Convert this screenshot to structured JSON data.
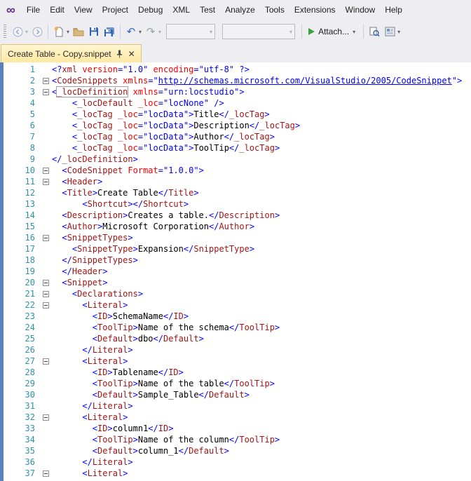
{
  "menu": {
    "items": [
      "File",
      "Edit",
      "View",
      "Project",
      "Debug",
      "XML",
      "Test",
      "Analyze",
      "Tools",
      "Extensions",
      "Window",
      "Help"
    ]
  },
  "toolbar": {
    "attach_label": "Attach...",
    "combo1_value": "",
    "combo2_value": ""
  },
  "tabs": [
    {
      "label": "Create Table - Copy.snippet",
      "pinned": true,
      "active": true
    }
  ],
  "colors": {
    "menu_bg": "#EEEEF2",
    "active_tab": "#FFE8A2",
    "window_border": "#5B82BE",
    "line_number": "#2B91AF",
    "xml_element": "#A31515",
    "xml_attribute": "#FF0000",
    "xml_delimiter_value": "#0000FF",
    "xml_text": "#000000",
    "attach_play": "#37A437",
    "logo_purple": "#5C2D91"
  },
  "editor": {
    "fold_lines": [
      2,
      3,
      10,
      11,
      16,
      20,
      21,
      22,
      27,
      32,
      37
    ],
    "lines": [
      [
        [
          "d",
          "<?"
        ],
        [
          "e",
          "xml"
        ],
        [
          "a",
          " version"
        ],
        [
          "d",
          "="
        ],
        [
          "v",
          "\"1.0\""
        ],
        [
          "a",
          " encoding"
        ],
        [
          "d",
          "="
        ],
        [
          "v",
          "\"utf-8\""
        ],
        [
          "d",
          " ?>"
        ]
      ],
      [
        [
          "d",
          "<"
        ],
        [
          "e",
          "CodeSnippets"
        ],
        [
          "a",
          " xmlns"
        ],
        [
          "d",
          "=\""
        ],
        [
          "u",
          "http://schemas.microsoft.com/VisualStudio/2005/CodeSnippet"
        ],
        [
          "d",
          "\">"
        ]
      ],
      [
        [
          "d",
          "<"
        ],
        [
          "b",
          "_locDefinition"
        ],
        [
          "a",
          " xmlns"
        ],
        [
          "d",
          "="
        ],
        [
          "v",
          "\"urn:locstudio\""
        ],
        [
          "d",
          ">"
        ]
      ],
      [
        [
          "t",
          "    "
        ],
        [
          "d",
          "<"
        ],
        [
          "e",
          "_locDefault"
        ],
        [
          "a",
          " _loc"
        ],
        [
          "d",
          "="
        ],
        [
          "v",
          "\"locNone\""
        ],
        [
          "d",
          " />"
        ]
      ],
      [
        [
          "t",
          "    "
        ],
        [
          "d",
          "<"
        ],
        [
          "e",
          "_locTag"
        ],
        [
          "a",
          " _loc"
        ],
        [
          "d",
          "="
        ],
        [
          "v",
          "\"locData\""
        ],
        [
          "d",
          ">"
        ],
        [
          "t",
          "Title"
        ],
        [
          "d",
          "</"
        ],
        [
          "e",
          "_locTag"
        ],
        [
          "d",
          ">"
        ]
      ],
      [
        [
          "t",
          "    "
        ],
        [
          "d",
          "<"
        ],
        [
          "e",
          "_locTag"
        ],
        [
          "a",
          " _loc"
        ],
        [
          "d",
          "="
        ],
        [
          "v",
          "\"locData\""
        ],
        [
          "d",
          ">"
        ],
        [
          "t",
          "Description"
        ],
        [
          "d",
          "</"
        ],
        [
          "e",
          "_locTag"
        ],
        [
          "d",
          ">"
        ]
      ],
      [
        [
          "t",
          "    "
        ],
        [
          "d",
          "<"
        ],
        [
          "e",
          "_locTag"
        ],
        [
          "a",
          " _loc"
        ],
        [
          "d",
          "="
        ],
        [
          "v",
          "\"locData\""
        ],
        [
          "d",
          ">"
        ],
        [
          "t",
          "Author"
        ],
        [
          "d",
          "</"
        ],
        [
          "e",
          "_locTag"
        ],
        [
          "d",
          ">"
        ]
      ],
      [
        [
          "t",
          "    "
        ],
        [
          "d",
          "<"
        ],
        [
          "e",
          "_locTag"
        ],
        [
          "a",
          " _loc"
        ],
        [
          "d",
          "="
        ],
        [
          "v",
          "\"locData\""
        ],
        [
          "d",
          ">"
        ],
        [
          "t",
          "ToolTip"
        ],
        [
          "d",
          "</"
        ],
        [
          "e",
          "_locTag"
        ],
        [
          "d",
          ">"
        ]
      ],
      [
        [
          "d",
          "</"
        ],
        [
          "e",
          "_locDefinition"
        ],
        [
          "d",
          ">"
        ]
      ],
      [
        [
          "t",
          "  "
        ],
        [
          "d",
          "<"
        ],
        [
          "e",
          "CodeSnippet"
        ],
        [
          "a",
          " Format"
        ],
        [
          "d",
          "="
        ],
        [
          "v",
          "\"1.0.0\""
        ],
        [
          "d",
          ">"
        ]
      ],
      [
        [
          "t",
          "  "
        ],
        [
          "d",
          "<"
        ],
        [
          "e",
          "Header"
        ],
        [
          "d",
          ">"
        ]
      ],
      [
        [
          "t",
          "  "
        ],
        [
          "d",
          "<"
        ],
        [
          "e",
          "Title"
        ],
        [
          "d",
          ">"
        ],
        [
          "t",
          "Create Table"
        ],
        [
          "d",
          "</"
        ],
        [
          "e",
          "Title"
        ],
        [
          "d",
          ">"
        ]
      ],
      [
        [
          "t",
          "      "
        ],
        [
          "d",
          "<"
        ],
        [
          "e",
          "Shortcut"
        ],
        [
          "d",
          "></"
        ],
        [
          "e",
          "Shortcut"
        ],
        [
          "d",
          ">"
        ]
      ],
      [
        [
          "t",
          "  "
        ],
        [
          "d",
          "<"
        ],
        [
          "e",
          "Description"
        ],
        [
          "d",
          ">"
        ],
        [
          "t",
          "Creates a table."
        ],
        [
          "d",
          "</"
        ],
        [
          "e",
          "Description"
        ],
        [
          "d",
          ">"
        ]
      ],
      [
        [
          "t",
          "  "
        ],
        [
          "d",
          "<"
        ],
        [
          "e",
          "Author"
        ],
        [
          "d",
          ">"
        ],
        [
          "t",
          "Microsoft Corporation"
        ],
        [
          "d",
          "</"
        ],
        [
          "e",
          "Author"
        ],
        [
          "d",
          ">"
        ]
      ],
      [
        [
          "t",
          "  "
        ],
        [
          "d",
          "<"
        ],
        [
          "e",
          "SnippetTypes"
        ],
        [
          "d",
          ">"
        ]
      ],
      [
        [
          "t",
          "    "
        ],
        [
          "d",
          "<"
        ],
        [
          "e",
          "SnippetType"
        ],
        [
          "d",
          ">"
        ],
        [
          "t",
          "Expansion"
        ],
        [
          "d",
          "</"
        ],
        [
          "e",
          "SnippetType"
        ],
        [
          "d",
          ">"
        ]
      ],
      [
        [
          "t",
          "  "
        ],
        [
          "d",
          "</"
        ],
        [
          "e",
          "SnippetTypes"
        ],
        [
          "d",
          ">"
        ]
      ],
      [
        [
          "t",
          "  "
        ],
        [
          "d",
          "</"
        ],
        [
          "e",
          "Header"
        ],
        [
          "d",
          ">"
        ]
      ],
      [
        [
          "t",
          "  "
        ],
        [
          "d",
          "<"
        ],
        [
          "e",
          "Snippet"
        ],
        [
          "d",
          ">"
        ]
      ],
      [
        [
          "t",
          "    "
        ],
        [
          "d",
          "<"
        ],
        [
          "e",
          "Declarations"
        ],
        [
          "d",
          ">"
        ]
      ],
      [
        [
          "t",
          "      "
        ],
        [
          "d",
          "<"
        ],
        [
          "e",
          "Literal"
        ],
        [
          "d",
          ">"
        ]
      ],
      [
        [
          "t",
          "        "
        ],
        [
          "d",
          "<"
        ],
        [
          "e",
          "ID"
        ],
        [
          "d",
          ">"
        ],
        [
          "t",
          "SchemaName"
        ],
        [
          "d",
          "</"
        ],
        [
          "e",
          "ID"
        ],
        [
          "d",
          ">"
        ]
      ],
      [
        [
          "t",
          "        "
        ],
        [
          "d",
          "<"
        ],
        [
          "e",
          "ToolTip"
        ],
        [
          "d",
          ">"
        ],
        [
          "t",
          "Name of the schema"
        ],
        [
          "d",
          "</"
        ],
        [
          "e",
          "ToolTip"
        ],
        [
          "d",
          ">"
        ]
      ],
      [
        [
          "t",
          "        "
        ],
        [
          "d",
          "<"
        ],
        [
          "e",
          "Default"
        ],
        [
          "d",
          ">"
        ],
        [
          "t",
          "dbo"
        ],
        [
          "d",
          "</"
        ],
        [
          "e",
          "Default"
        ],
        [
          "d",
          ">"
        ]
      ],
      [
        [
          "t",
          "      "
        ],
        [
          "d",
          "</"
        ],
        [
          "e",
          "Literal"
        ],
        [
          "d",
          ">"
        ]
      ],
      [
        [
          "t",
          "      "
        ],
        [
          "d",
          "<"
        ],
        [
          "e",
          "Literal"
        ],
        [
          "d",
          ">"
        ]
      ],
      [
        [
          "t",
          "        "
        ],
        [
          "d",
          "<"
        ],
        [
          "e",
          "ID"
        ],
        [
          "d",
          ">"
        ],
        [
          "t",
          "Tablename"
        ],
        [
          "d",
          "</"
        ],
        [
          "e",
          "ID"
        ],
        [
          "d",
          ">"
        ]
      ],
      [
        [
          "t",
          "        "
        ],
        [
          "d",
          "<"
        ],
        [
          "e",
          "ToolTip"
        ],
        [
          "d",
          ">"
        ],
        [
          "t",
          "Name of the table"
        ],
        [
          "d",
          "</"
        ],
        [
          "e",
          "ToolTip"
        ],
        [
          "d",
          ">"
        ]
      ],
      [
        [
          "t",
          "        "
        ],
        [
          "d",
          "<"
        ],
        [
          "e",
          "Default"
        ],
        [
          "d",
          ">"
        ],
        [
          "t",
          "Sample_Table"
        ],
        [
          "d",
          "</"
        ],
        [
          "e",
          "Default"
        ],
        [
          "d",
          ">"
        ]
      ],
      [
        [
          "t",
          "      "
        ],
        [
          "d",
          "</"
        ],
        [
          "e",
          "Literal"
        ],
        [
          "d",
          ">"
        ]
      ],
      [
        [
          "t",
          "      "
        ],
        [
          "d",
          "<"
        ],
        [
          "e",
          "Literal"
        ],
        [
          "d",
          ">"
        ]
      ],
      [
        [
          "t",
          "        "
        ],
        [
          "d",
          "<"
        ],
        [
          "e",
          "ID"
        ],
        [
          "d",
          ">"
        ],
        [
          "t",
          "column1"
        ],
        [
          "d",
          "</"
        ],
        [
          "e",
          "ID"
        ],
        [
          "d",
          ">"
        ]
      ],
      [
        [
          "t",
          "        "
        ],
        [
          "d",
          "<"
        ],
        [
          "e",
          "ToolTip"
        ],
        [
          "d",
          ">"
        ],
        [
          "t",
          "Name of the column"
        ],
        [
          "d",
          "</"
        ],
        [
          "e",
          "ToolTip"
        ],
        [
          "d",
          ">"
        ]
      ],
      [
        [
          "t",
          "        "
        ],
        [
          "d",
          "<"
        ],
        [
          "e",
          "Default"
        ],
        [
          "d",
          ">"
        ],
        [
          "t",
          "column_1"
        ],
        [
          "d",
          "</"
        ],
        [
          "e",
          "Default"
        ],
        [
          "d",
          ">"
        ]
      ],
      [
        [
          "t",
          "      "
        ],
        [
          "d",
          "</"
        ],
        [
          "e",
          "Literal"
        ],
        [
          "d",
          ">"
        ]
      ],
      [
        [
          "t",
          "      "
        ],
        [
          "d",
          "<"
        ],
        [
          "e",
          "Literal"
        ],
        [
          "d",
          ">"
        ]
      ]
    ]
  }
}
